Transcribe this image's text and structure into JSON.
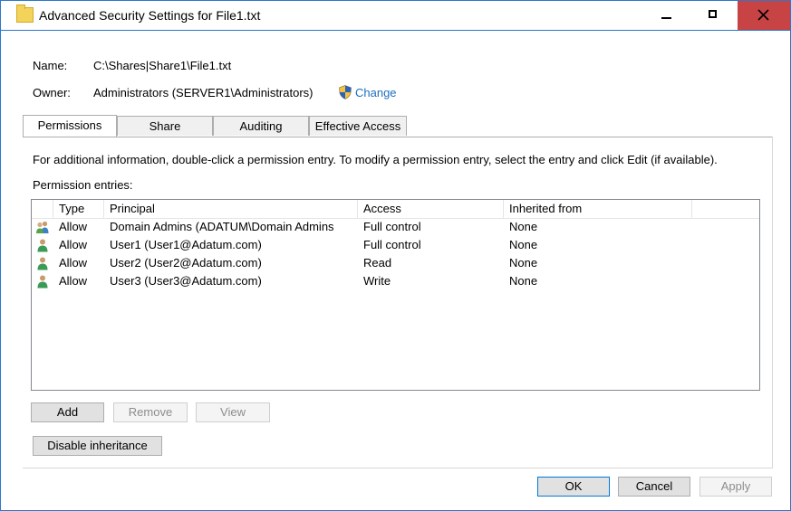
{
  "window": {
    "title": "Advanced Security Settings for File1.txt",
    "icon": "folder-icon"
  },
  "info": {
    "name_label": "Name:",
    "name_value": "C:\\Shares|Share1\\File1.txt",
    "owner_label": "Owner:",
    "owner_value": "Administrators (SERVER1\\Administrators)",
    "change_link": "Change"
  },
  "tabs": [
    {
      "label": "Permissions",
      "active": true
    },
    {
      "label": "Share",
      "active": false
    },
    {
      "label": "Auditing",
      "active": false
    },
    {
      "label": "Effective Access",
      "active": false
    }
  ],
  "instructions": "For additional information, double-click a permission entry. To modify a permission entry, select the entry and click Edit (if available).",
  "entries_label": "Permission entries:",
  "columns": [
    "Type",
    "Principal",
    "Access",
    "Inherited from"
  ],
  "entries": [
    {
      "icon": "group-icon",
      "type": "Allow",
      "principal": "Domain Admins (ADATUM\\Domain Admins",
      "access": "Full control",
      "inherited": "None"
    },
    {
      "icon": "user-icon",
      "type": "Allow",
      "principal": "User1 (User1@Adatum.com)",
      "access": "Full control",
      "inherited": "None"
    },
    {
      "icon": "user-icon",
      "type": "Allow",
      "principal": "User2 (User2@Adatum.com)",
      "access": "Read",
      "inherited": "None"
    },
    {
      "icon": "user-icon",
      "type": "Allow",
      "principal": "User3 (User3@Adatum.com)",
      "access": "Write",
      "inherited": "None"
    }
  ],
  "buttons": {
    "add": "Add",
    "remove": "Remove",
    "view": "View",
    "disable_inheritance": "Disable inheritance",
    "ok": "OK",
    "cancel": "Cancel",
    "apply": "Apply"
  },
  "colors": {
    "accent": "#2b78c9",
    "close": "#c84444",
    "link": "#1e6fbf"
  }
}
